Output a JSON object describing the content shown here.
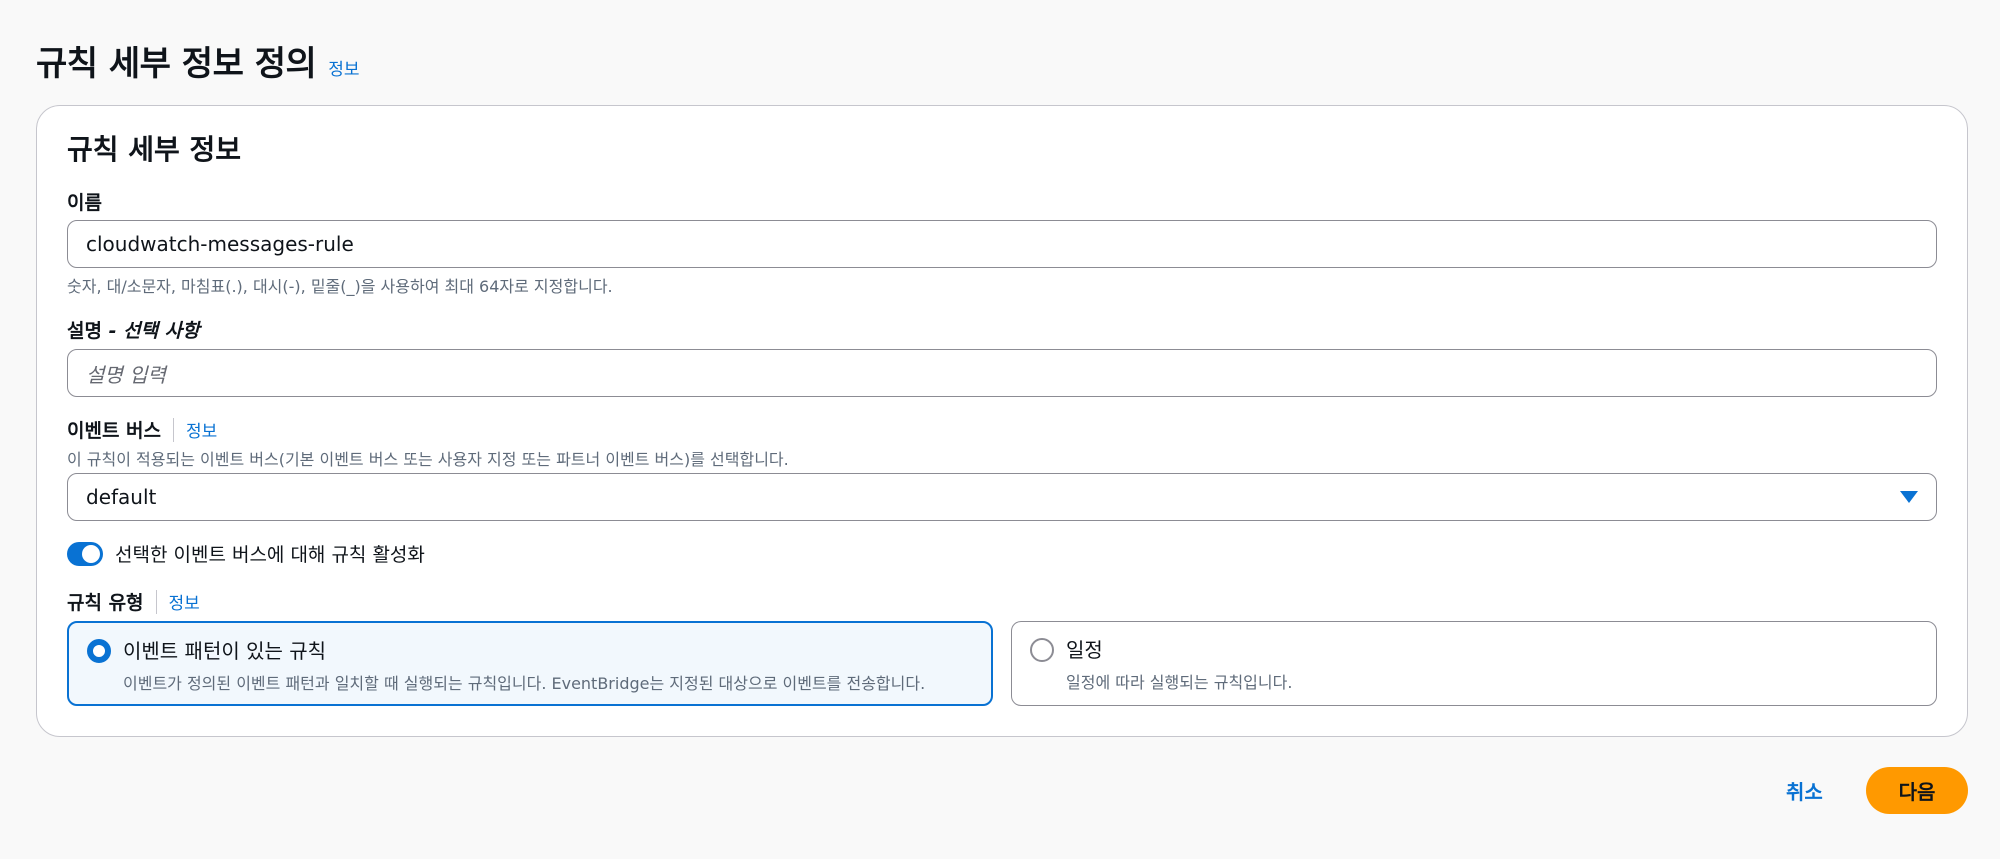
{
  "page": {
    "title": "규칙 세부 정보 정의",
    "info": "정보"
  },
  "container": {
    "title": "규칙 세부 정보"
  },
  "name_field": {
    "label": "이름",
    "value": "cloudwatch-messages-rule",
    "constraint": "숫자, 대/소문자, 마침표(.), 대시(-), 밑줄(_)을 사용하여 최대 64자로 지정합니다."
  },
  "description_field": {
    "label": "설명",
    "optional": "- 선택 사항",
    "placeholder": "설명 입력"
  },
  "event_bus": {
    "label": "이벤트 버스",
    "info": "정보",
    "description": "이 규칙이 적용되는 이벤트 버스(기본 이벤트 버스 또는 사용자 지정 또는 파트너 이벤트 버스)를 선택합니다.",
    "selected": "default",
    "toggle_label": "선택한 이벤트 버스에 대해 규칙 활성화",
    "toggle_on": true
  },
  "rule_type": {
    "label": "규칙 유형",
    "info": "정보",
    "options": [
      {
        "title": "이벤트 패턴이 있는 규칙",
        "description": "이벤트가 정의된 이벤트 패턴과 일치할 때 실행되는 규칙입니다. EventBridge는 지정된 대상으로 이벤트를 전송합니다.",
        "selected": true
      },
      {
        "title": "일정",
        "description": "일정에 따라 실행되는 규칙입니다.",
        "selected": false
      }
    ]
  },
  "actions": {
    "cancel": "취소",
    "next": "다음"
  },
  "colors": {
    "accent": "#0972d3",
    "primary_button": "#ff9900",
    "selected_tile_bg": "#f2f8fd"
  }
}
